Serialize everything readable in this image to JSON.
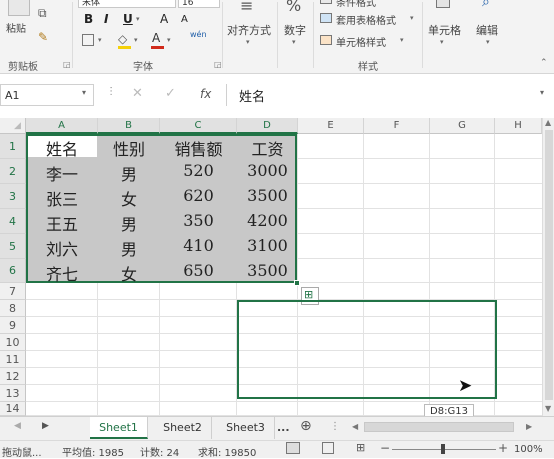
{
  "ribbon": {
    "clipboard": {
      "paste_label": "粘贴",
      "group_label": "剪贴板"
    },
    "font": {
      "font_name": "宋体",
      "font_size": "16",
      "bold": "B",
      "italic": "I",
      "underline": "U",
      "grow": "A",
      "shrink": "A",
      "wen": "wén",
      "group_label": "字体"
    },
    "alignment": {
      "label": "对齐方式"
    },
    "number": {
      "label": "数字"
    },
    "styles": {
      "cond_label": "条件格式",
      "table_label": "套用表格格式",
      "cell_style_label": "单元格样式",
      "group_label": "样式"
    },
    "cells": {
      "label": "单元格"
    },
    "editing": {
      "label": "编辑"
    }
  },
  "formula_bar": {
    "name_box": "A1",
    "fx": "fx",
    "content": "姓名"
  },
  "columns": [
    "A",
    "B",
    "C",
    "D",
    "E",
    "F",
    "G",
    "H"
  ],
  "rows": [
    "1",
    "2",
    "3",
    "4",
    "5",
    "6",
    "7",
    "8",
    "9",
    "10",
    "11",
    "12",
    "13",
    "14"
  ],
  "table": {
    "header": [
      "姓名",
      "性别",
      "销售额",
      "工资"
    ],
    "rows": [
      [
        "李一",
        "男",
        "520",
        "3000"
      ],
      [
        "张三",
        "女",
        "620",
        "3500"
      ],
      [
        "王五",
        "男",
        "350",
        "4200"
      ],
      [
        "刘六",
        "男",
        "410",
        "3100"
      ],
      [
        "齐七",
        "女",
        "650",
        "3500"
      ]
    ]
  },
  "tooltip": "D8:G13",
  "sheets": [
    "Sheet1",
    "Sheet2",
    "Sheet3"
  ],
  "sheet_more": "...",
  "status": {
    "mode": "拖动鼠...",
    "average": "平均值: 1985",
    "count": "计数: 24",
    "sum": "求和: 19850",
    "zoom": "100%"
  },
  "accent_color": "#217346"
}
